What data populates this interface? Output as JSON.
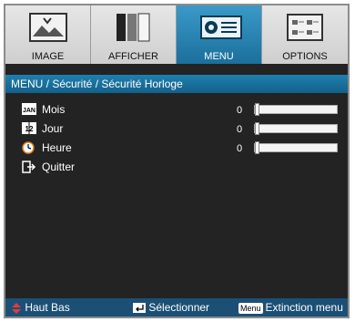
{
  "tabs": [
    {
      "label": "IMAGE",
      "icon": "image-icon"
    },
    {
      "label": "AFFICHER",
      "icon": "display-icon"
    },
    {
      "label": "MENU",
      "icon": "projector-icon",
      "active": true
    },
    {
      "label": "OPTIONS",
      "icon": "options-icon"
    }
  ],
  "breadcrumb": "MENU / Sécurité / Sécurité Horloge",
  "rows": [
    {
      "label": "Mois",
      "value": "0",
      "icon": "calendar-icon",
      "icon_text": "JAN"
    },
    {
      "label": "Jour",
      "value": "0",
      "icon": "date-icon",
      "icon_text": "12"
    },
    {
      "label": "Heure",
      "value": "0",
      "icon": "clock-icon"
    },
    {
      "label": "Quitter",
      "icon": "exit-icon"
    }
  ],
  "footer": {
    "nav": "Haut Bas",
    "select": "Sélectionner",
    "menu_key": "Menu",
    "exit": "Extinction menu"
  },
  "colors": {
    "accent": "#1e7fae",
    "background": "#232323",
    "footer": "#1b4f75"
  }
}
